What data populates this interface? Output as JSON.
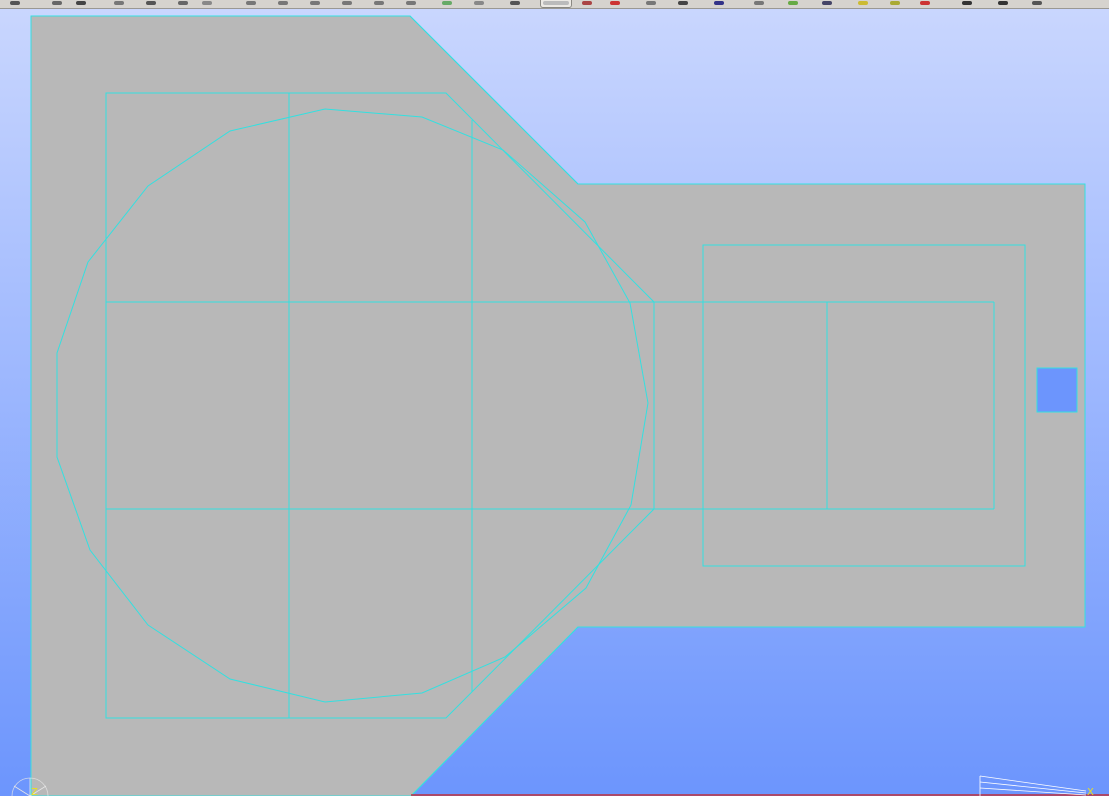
{
  "colors": {
    "background_top": "#c9d6fe",
    "background_bottom": "#6c95fd",
    "body_fill": "#b8b8b8",
    "wireframe": "#33e0e0",
    "axis_label": "#e8e020",
    "axis_line": "#ffffff",
    "toolbar": "#d6d3ce"
  },
  "toolbar": {
    "buttons": [
      {
        "icon": "select-arrow-icon"
      },
      {
        "icon": "pointer-icon"
      },
      {
        "icon": "undo-icon"
      },
      {
        "icon": "redo-icon"
      },
      {
        "icon": "rotate-icon"
      },
      {
        "icon": "pan-icon"
      },
      {
        "icon": "zoom-icon"
      },
      {
        "icon": "view-front-icon"
      },
      {
        "icon": "view-back-icon"
      },
      {
        "icon": "view-left-icon"
      },
      {
        "icon": "view-right-icon"
      },
      {
        "icon": "view-top-icon"
      },
      {
        "icon": "view-bottom-icon"
      },
      {
        "icon": "view-iso-icon"
      },
      {
        "icon": "wireframe-icon"
      },
      {
        "icon": "shaded-icon"
      },
      {
        "icon": "shaded-edges-icon",
        "active": true
      },
      {
        "icon": "hidden-line-icon"
      },
      {
        "icon": "color-icon"
      },
      {
        "icon": "material-icon"
      },
      {
        "icon": "clip-plane-icon"
      },
      {
        "icon": "section-icon"
      },
      {
        "icon": "measure-icon"
      },
      {
        "icon": "grid-icon"
      },
      {
        "icon": "axes-icon"
      },
      {
        "icon": "export-image-icon"
      },
      {
        "icon": "light-icon"
      },
      {
        "icon": "delete-icon"
      },
      {
        "icon": "filter-icon"
      },
      {
        "icon": "camera-icon"
      },
      {
        "icon": "settings-icon"
      }
    ]
  },
  "axes": {
    "z_label": "Z",
    "x_label": "X"
  }
}
